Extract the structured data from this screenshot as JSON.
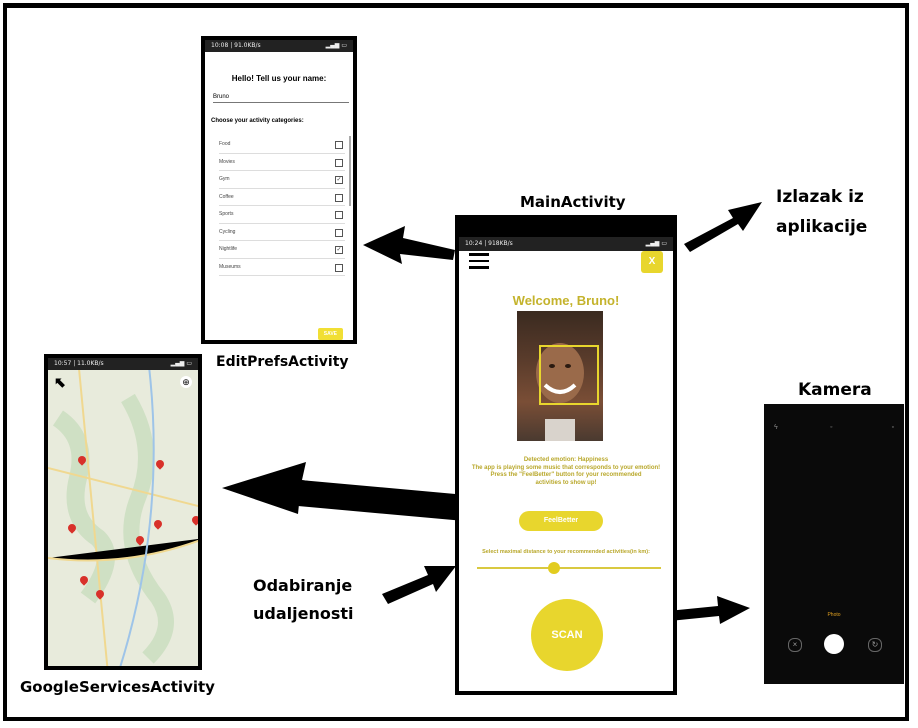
{
  "labels": {
    "main_activity": "MainActivity",
    "exit": "Izlazak iz\naplikacije",
    "edit_prefs": "EditPrefsActivity",
    "camera": "Kamera",
    "distance": "Odabiranje\nudaljenosti",
    "google_services": "GoogleServicesActivity"
  },
  "edit_prefs_screen": {
    "status": "10:08 | 91.0KB/s",
    "title": "Hello! Tell us your name:",
    "name_value": "Bruno",
    "choose_label": "Choose your activity categories:",
    "categories": [
      {
        "label": "Food",
        "checked": false
      },
      {
        "label": "Movies",
        "checked": false
      },
      {
        "label": "Gym",
        "checked": true
      },
      {
        "label": "Coffee",
        "checked": false
      },
      {
        "label": "Sports",
        "checked": false
      },
      {
        "label": "Cycling",
        "checked": false
      },
      {
        "label": "Nightlife",
        "checked": true
      },
      {
        "label": "Museums",
        "checked": false
      }
    ],
    "save_label": "SAVE"
  },
  "main_screen": {
    "status": "10:24 | 918KB/s",
    "exit_button": "X",
    "welcome": "Welcome, Bruno!",
    "emotion_text": "Detected emotion: Happiness\nThe app is playing some music that corresponds to your emotion!\nPress the \"FeelBetter\" button for your recommended\nactivities to show up!",
    "feelbetter_label": "FeelBetter",
    "max_distance_label": "Select maximal distance to your recommended activities(in km):",
    "slider_value": 0.42,
    "scan_label": "SCAN"
  },
  "map_screen": {
    "status": "10:57 | 11.0KB/s"
  },
  "camera_screen": {
    "mode_label": "Photo"
  },
  "colors": {
    "accent": "#e8d62d",
    "text_accent": "#c4b32c"
  }
}
